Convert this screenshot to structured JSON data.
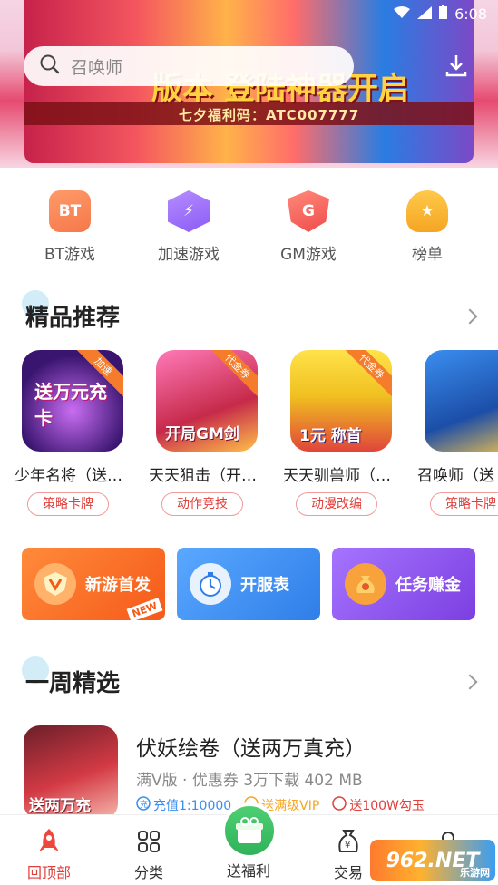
{
  "status": {
    "time": "6:08"
  },
  "banner": {
    "headline": "七夕福利码：ATC007777",
    "title": "版本 登陆神器开启"
  },
  "search": {
    "placeholder": "召唤师"
  },
  "quick_links": [
    {
      "label": "BT游戏",
      "icon": "bt-icon",
      "badge": "BT",
      "color": "#f5784a"
    },
    {
      "label": "加速游戏",
      "icon": "lightning-icon",
      "badge": "⚡",
      "color": "#8b5cf6"
    },
    {
      "label": "GM游戏",
      "icon": "gm-shield-icon",
      "badge": "G",
      "color": "#ef4b4b"
    },
    {
      "label": "榜单",
      "icon": "trophy-icon",
      "badge": "★",
      "color": "#f5a524"
    }
  ],
  "featured": {
    "title": "精品推荐",
    "games": [
      {
        "name": "少年名将（送…",
        "category": "策略卡牌",
        "ribbon": "加速",
        "art_text": "送万元充卡"
      },
      {
        "name": "天天狙击（开…",
        "category": "动作竞技",
        "ribbon": "代金券",
        "art_text": "开局GM剑"
      },
      {
        "name": "天天驯兽师（…",
        "category": "动漫改编",
        "ribbon": "代金券",
        "art_text": "1元 称首"
      },
      {
        "name": "召唤师（送",
        "category": "策略卡牌",
        "ribbon": "",
        "art_text": ""
      }
    ]
  },
  "promos": [
    {
      "label": "新游首发",
      "icon": "shield-v-icon",
      "badge": "NEW",
      "color": "#fa6a2a"
    },
    {
      "label": "开服表",
      "icon": "stopwatch-icon",
      "badge": "",
      "color": "#3a8ef0"
    },
    {
      "label": "任务赚金",
      "icon": "money-bag-icon",
      "badge": "",
      "color": "#8d4fe0"
    }
  ],
  "weekly": {
    "title": "一周精选",
    "item": {
      "name": "伏妖绘卷（送两万真充）",
      "meta": "满V版 · 优惠券  3万下载  402 MB",
      "tags": [
        {
          "text": "充值1:10000",
          "color": "#3a8ef0",
          "icon": "recharge-icon"
        },
        {
          "text": "送满级VIP",
          "color": "#f5a524",
          "icon": "vip-icon"
        },
        {
          "text": "送100W勾玉",
          "color": "#e0403c",
          "icon": "gift-icon"
        }
      ],
      "art_text": "送两万充"
    }
  },
  "tabs": [
    {
      "label": "回顶部",
      "icon": "rocket-icon",
      "active": true
    },
    {
      "label": "分类",
      "icon": "grid-icon",
      "active": false
    },
    {
      "label": "送福利",
      "icon": "gift-box-icon",
      "active": false
    },
    {
      "label": "交易",
      "icon": "money-pouch-icon",
      "active": false
    },
    {
      "label": "",
      "icon": "user-icon",
      "active": false
    }
  ],
  "watermark": {
    "text": "962.NET",
    "sub": "乐游网"
  }
}
